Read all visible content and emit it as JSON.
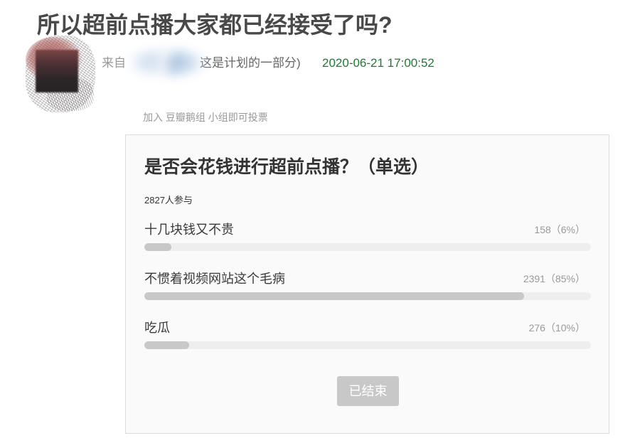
{
  "post": {
    "title": "所以超前点播大家都已经接受了吗?",
    "from_label": "来自",
    "author_suffix": "这是计划的一部分)",
    "time": "2020-06-21 17:00:52"
  },
  "poll": {
    "join_hint": "加入 豆瓣鹅组 小组即可投票",
    "question": "是否会花钱进行超前点播？（单选）",
    "participants": "2827人参与",
    "options": [
      {
        "label": "十几块钱又不贵",
        "count_text": "158（6%）",
        "percent": 6
      },
      {
        "label": "不惯着视频网站这个毛病",
        "count_text": "2391（85%）",
        "percent": 85
      },
      {
        "label": "吃瓜",
        "count_text": "276（10%）",
        "percent": 10
      }
    ],
    "button_label": "已结束"
  },
  "colors": {
    "time": "#1f7a32",
    "bar_track": "#eeeeee",
    "bar_fill": "#c8c8c8",
    "button_bg": "#c8c8c8",
    "box_bg": "#fafafa",
    "box_border": "#dddddd"
  }
}
